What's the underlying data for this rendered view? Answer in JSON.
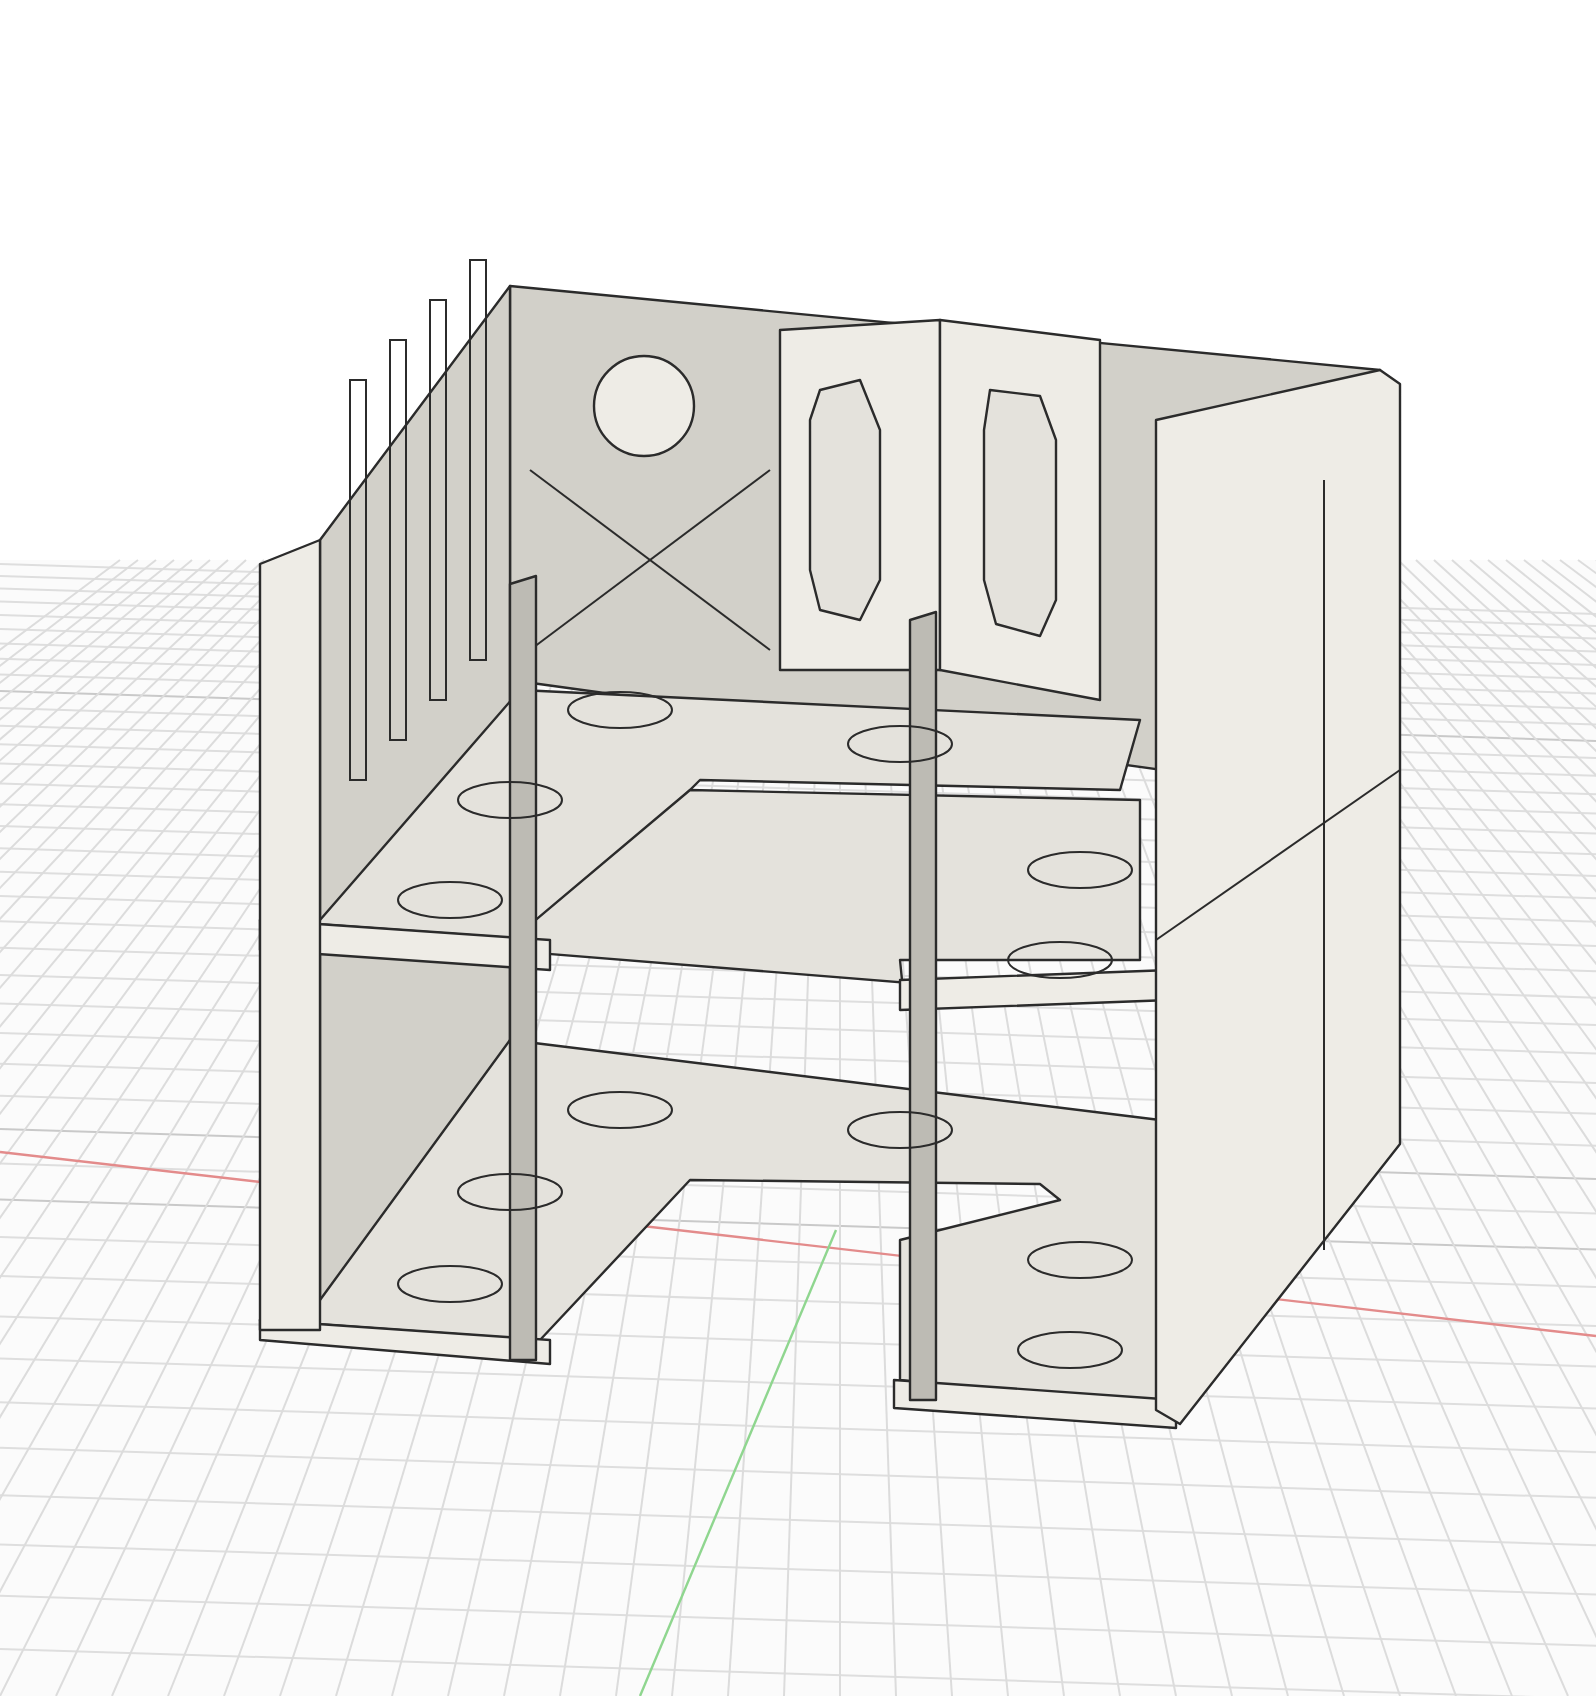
{
  "viewport": {
    "kind": "model"
  }
}
